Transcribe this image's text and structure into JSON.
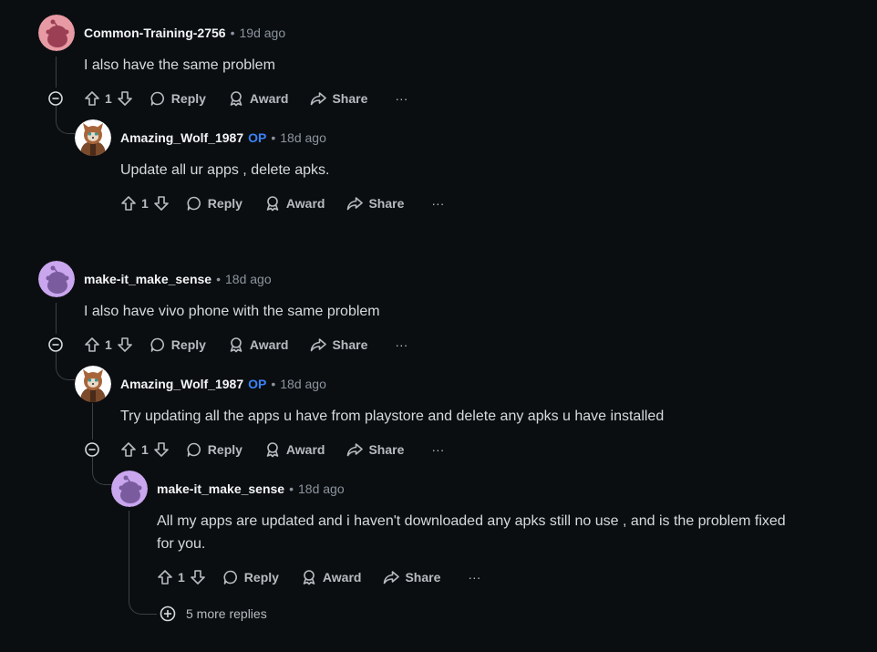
{
  "comments": [
    {
      "author": "Common-Training-2756",
      "op": "",
      "time": "19d ago",
      "body": "I also have the same problem",
      "votes": "1",
      "avatar_color": "#e89aa4"
    },
    {
      "author": "Amazing_Wolf_1987",
      "op": "OP",
      "time": "18d ago",
      "body": "Update all ur apps , delete apks.",
      "votes": "1"
    },
    {
      "author": "make-it_make_sense",
      "op": "",
      "time": "18d ago",
      "body": "I also have vivo phone with the same problem",
      "votes": "1",
      "avatar_color": "#c9a6ee"
    },
    {
      "author": "Amazing_Wolf_1987",
      "op": "OP",
      "time": "18d ago",
      "body": "Try updating all the apps u have from playstore and delete any apks u have installed",
      "votes": "1"
    },
    {
      "author": "make-it_make_sense",
      "op": "",
      "time": "18d ago",
      "body_line1": "All my apps are updated and i haven't downloaded any apks still no use , and is the problem fixed",
      "body_line2": "for you.",
      "votes": "1",
      "avatar_color": "#c9a6ee"
    }
  ],
  "actions": {
    "reply": "Reply",
    "award": "Award",
    "share": "Share",
    "more": "···"
  },
  "more_replies": "5 more replies",
  "separator": "•",
  "colors": {
    "background": "#0b0e11",
    "op_badge": "#3b82f6",
    "thread_line": "#3a4046"
  }
}
